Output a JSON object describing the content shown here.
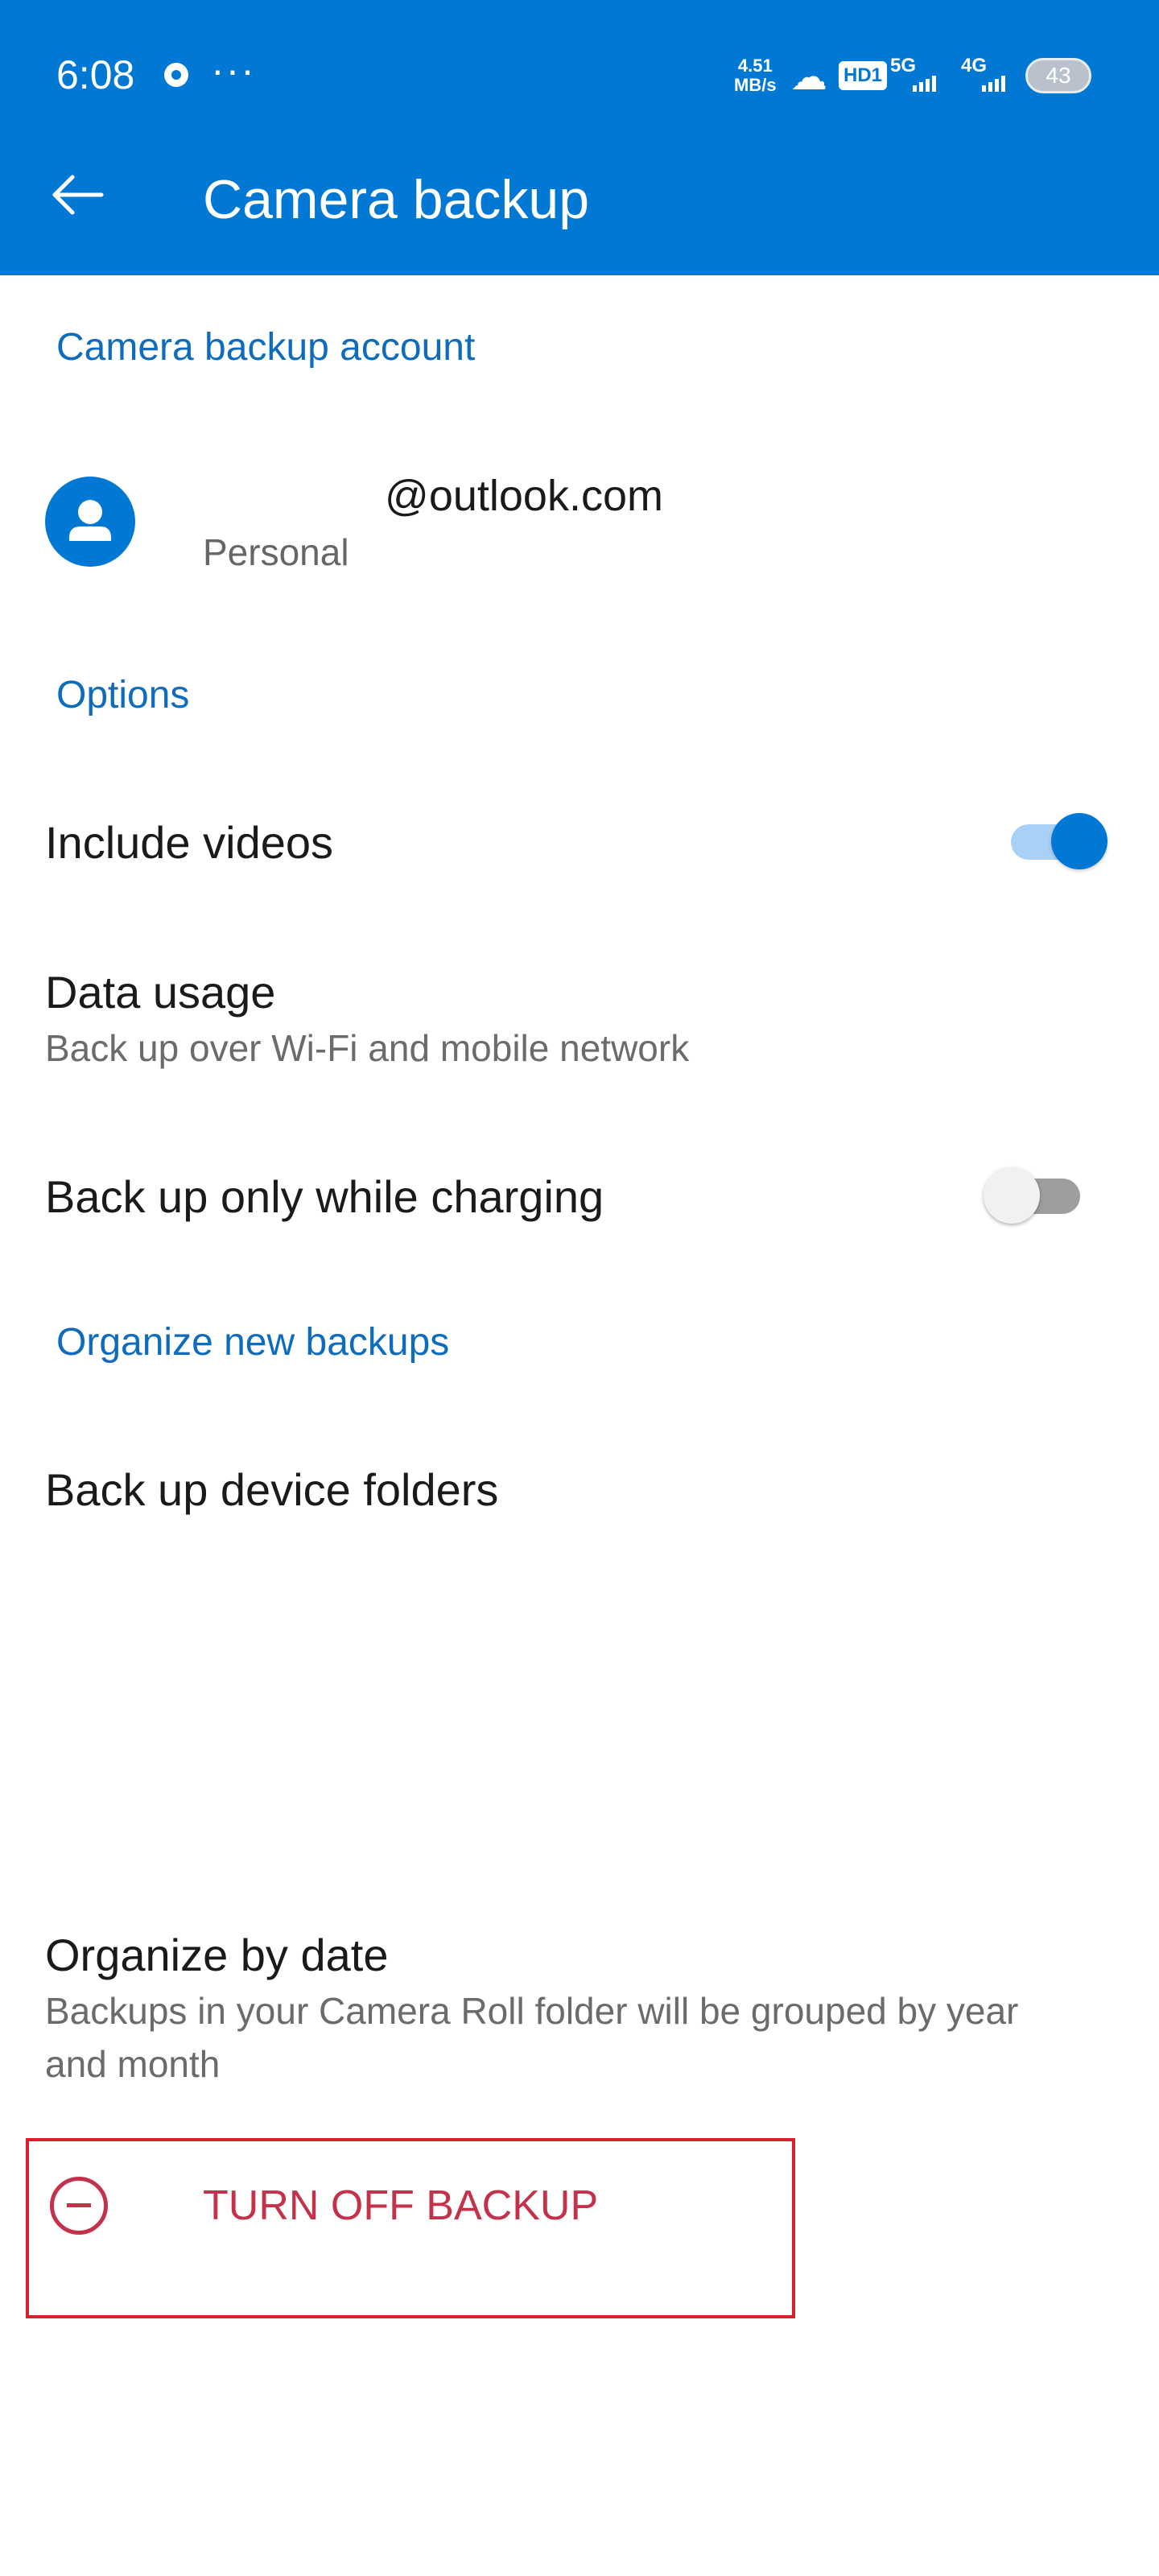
{
  "status_bar": {
    "time": "6:08",
    "more": "···",
    "speed_value": "4.51",
    "speed_unit": "MB/s",
    "hd_label": "HD1",
    "net1": "5G",
    "net2": "4G",
    "battery": "43"
  },
  "app_bar": {
    "title": "Camera backup",
    "back_icon": "back-arrow-icon"
  },
  "account_section": {
    "header": "Camera backup account",
    "email": "@outlook.com",
    "type": "Personal",
    "avatar_icon": "person-icon"
  },
  "options_section": {
    "header": "Options",
    "include_videos": {
      "label": "Include videos",
      "enabled": true
    },
    "data_usage": {
      "label": "Data usage",
      "value": "Back up over Wi-Fi and mobile network"
    },
    "charging": {
      "label": "Back up only while charging",
      "enabled": false
    }
  },
  "organize_section": {
    "header": "Organize new backups",
    "device_folders": "Back up device folders",
    "organize_by_date": {
      "label": "Organize by date",
      "description_line1": "Backups in your Camera Roll folder will be grouped by year",
      "description_line2": "and month"
    }
  },
  "turn_off": {
    "label": "TURN OFF BACKUP",
    "icon": "minus-circle-icon"
  },
  "colors": {
    "accent": "#0078d4",
    "section_header": "#0f6cbd",
    "danger": "#c4314b",
    "highlight_box": "#d9202e"
  }
}
